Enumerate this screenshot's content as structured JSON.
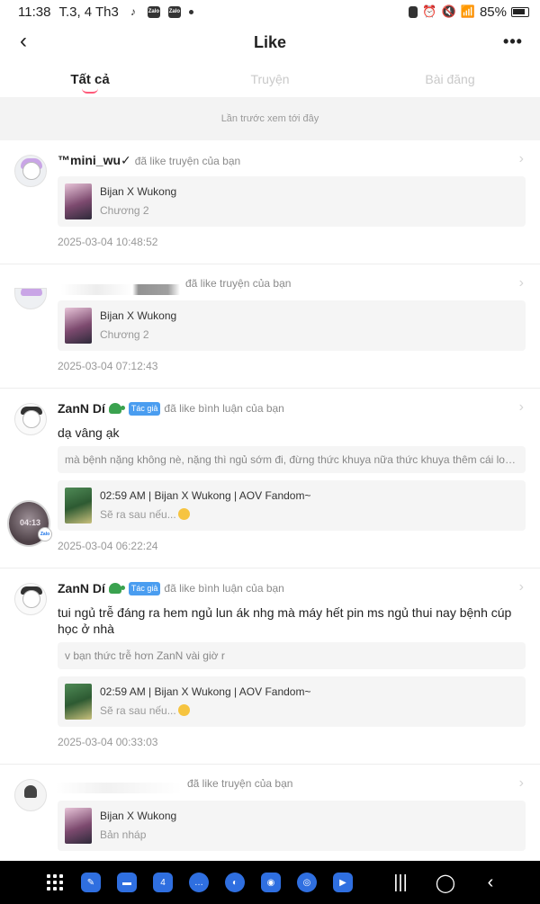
{
  "status_bar": {
    "time": "11:38",
    "date": "T.3, 4 Th3",
    "battery": "85%"
  },
  "header": {
    "title": "Like"
  },
  "tabs": [
    {
      "label": "Tất cả",
      "active": true
    },
    {
      "label": "Truyện",
      "active": false
    },
    {
      "label": "Bài đăng",
      "active": false
    }
  ],
  "notice": "Lần trước xem tới đây",
  "items": [
    {
      "username": "™mini_wu✓",
      "action": "đã like truyện của bạn",
      "card_title": "Bijan X Wukong",
      "card_sub": "Chương 2",
      "time": "2025-03-04 10:48:52"
    },
    {
      "username": "",
      "action": "đã like truyện của bạn",
      "card_title": "Bijan X Wukong",
      "card_sub": "Chương 2",
      "time": "2025-03-04 07:12:43"
    },
    {
      "username": "ZanN Dí",
      "badge": "Tác giả",
      "action": "đã like bình luận của bạn",
      "comment": "dạ vâng ạk",
      "quote": "mà bệnh nặng không nè, nặng thì ngủ sớm đi, đừng thức khuya nữa thức khuya thêm cái loét d...",
      "card_title": "02:59 AM | Bijan X Wukong | AOV Fandom~",
      "card_sub": "Sẽ ra sau nếu...",
      "time": "2025-03-04 06:22:24"
    },
    {
      "username": "ZanN Dí",
      "badge": "Tác giả",
      "action": "đã like bình luận của bạn",
      "comment": "tui ngủ trễ đáng ra hem ngủ lun ák nhg mà máy hết pin ms ngủ thui nay bệnh cúp học ở nhà",
      "quote": "v bạn thức trễ hơn ZanN vài giờ r",
      "card_title": "02:59 AM | Bijan X Wukong | AOV Fandom~",
      "card_sub": "Sẽ ra sau nếu...",
      "time": "2025-03-04 00:33:03"
    },
    {
      "username": "",
      "action": "đã like truyện của bạn",
      "card_title": "Bijan X Wukong",
      "card_sub": "Bản nháp"
    }
  ],
  "floating_bubble": {
    "label": "04:13"
  }
}
